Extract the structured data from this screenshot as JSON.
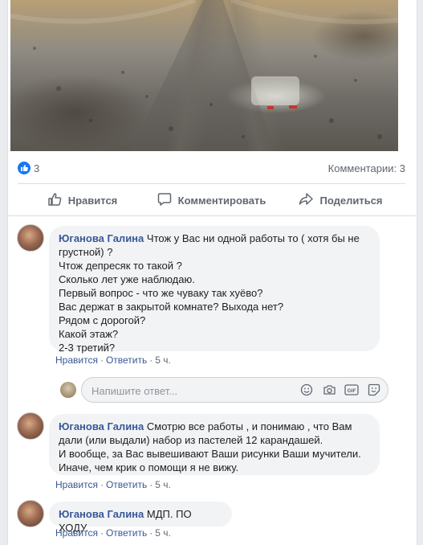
{
  "post": {
    "like_count": "3",
    "comments_count": "Комментарии: 3"
  },
  "actions": {
    "like": "Нравится",
    "comment": "Комментировать",
    "share": "Поделиться"
  },
  "comments": [
    {
      "author": "Юганова Галина",
      "lines": [
        "Чтож у Вас ни одной работы то ( хотя бы не",
        "грустной) ?",
        "Чтож депресяк то такой ?",
        "Сколько лет уже наблюдаю.",
        "Первый вопрос - что же чуваку так хуёво?",
        "Вас держат в закрытой комнате? Выхода нет?",
        "Рядом с дорогой?",
        "Какой этаж?",
        "2-3 третий?"
      ],
      "like_label": "Нравится",
      "reply_label": "Ответить",
      "time": "5 ч."
    },
    {
      "author": "Юганова Галина",
      "lines": [
        "Смотрю все работы , и понимаю , что Вам",
        "дали (или выдали) набор из пастелей 12 карандашей.",
        "И вообще, за Вас вывешивают Ваши рисунки Ваши мучители.",
        "Иначе, чем крик о помощи я не вижу."
      ],
      "like_label": "Нравится",
      "reply_label": "Ответить",
      "time": "5 ч."
    },
    {
      "author": "Юганова Галина",
      "lines": [
        "МДП. ПО ХОДУ."
      ],
      "like_label": "Нравится",
      "reply_label": "Ответить",
      "time": "5 ч."
    }
  ],
  "reply": {
    "placeholder": "Напишите ответ..."
  },
  "icons": {
    "like": "thumbs-up-icon",
    "comment": "speech-bubble-icon",
    "share": "share-arrow-icon",
    "emoji": "emoji-icon",
    "camera": "camera-icon",
    "gif": "gif-icon",
    "sticker": "sticker-icon"
  },
  "colors": {
    "link": "#385898",
    "brand": "#1877f2",
    "muted": "#606770",
    "bubble": "#f2f3f5"
  }
}
